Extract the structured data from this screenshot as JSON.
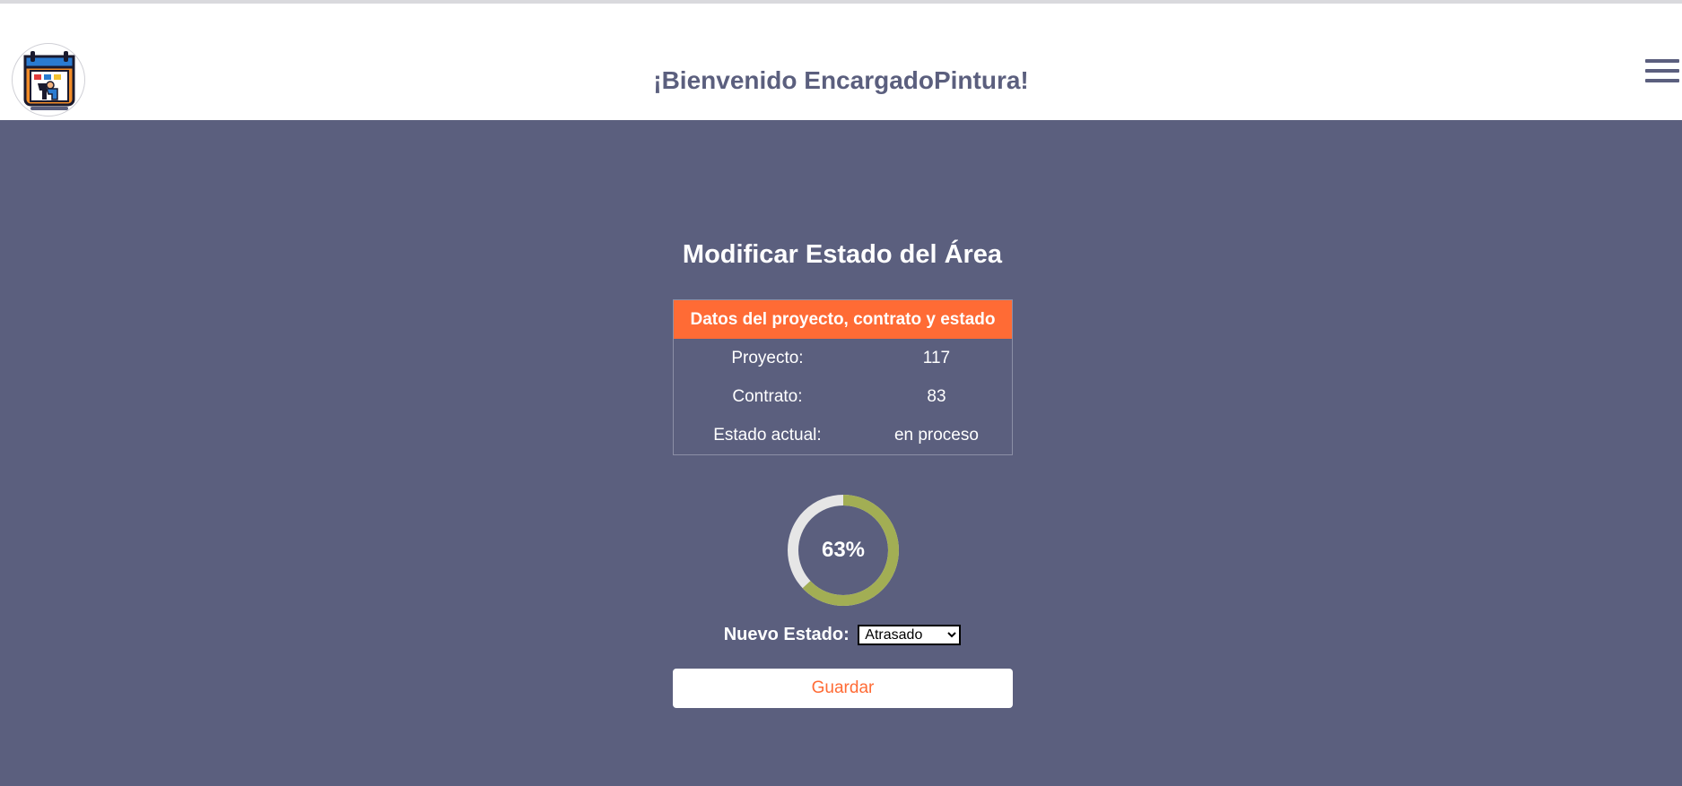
{
  "header": {
    "title": "¡Bienvenido EncargadoPintura!",
    "logo_icon": "calendar-worker-logo-icon",
    "menu_icon": "hamburger-menu-icon"
  },
  "main": {
    "title": "Modificar Estado del Área",
    "table": {
      "heading": "Datos del proyecto, contrato y estado",
      "rows": [
        {
          "label": "Proyecto:",
          "value": "117"
        },
        {
          "label": "Contrato:",
          "value": "83"
        },
        {
          "label": "Estado actual:",
          "value": "en proceso"
        }
      ]
    },
    "progress": {
      "percent_value": 63,
      "label": "63%"
    },
    "status_select": {
      "label": "Nuevo Estado:",
      "selected": "Atrasado"
    },
    "save_label": "Guardar"
  },
  "colors": {
    "background": "#5b5f7e",
    "accent": "#ff6b35",
    "progress_fill": "#a2ae54",
    "progress_track": "#e6e6e6"
  }
}
